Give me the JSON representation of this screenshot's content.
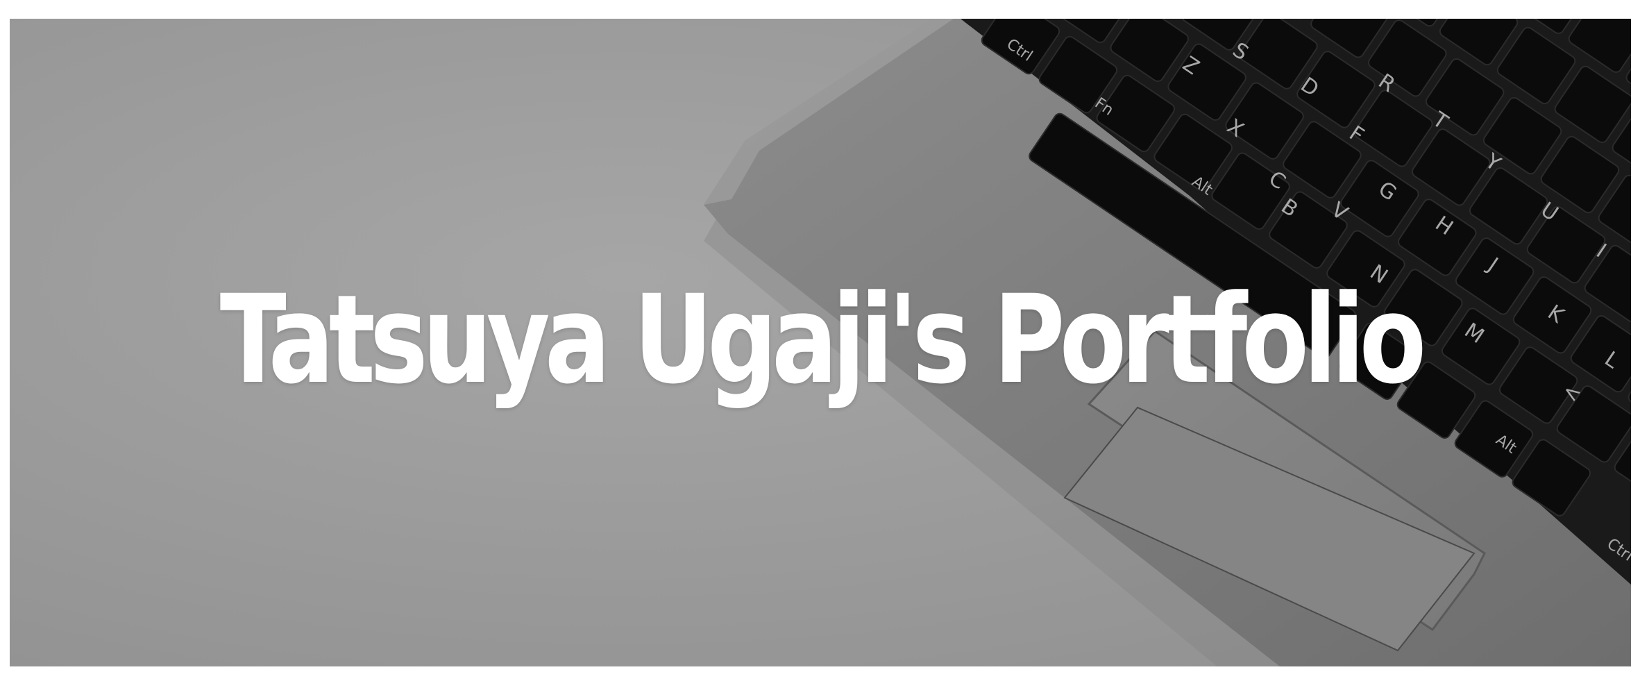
{
  "hero": {
    "title": "Tatsuya Ugaji's Portfolio",
    "background_image": "laptop-keyboard-photo"
  },
  "colors": {
    "page_background": "#ffffff",
    "overlay_gray": "#9c9c9c",
    "title_text": "#ffffff",
    "keyboard_keys": "#0c0c0c"
  }
}
